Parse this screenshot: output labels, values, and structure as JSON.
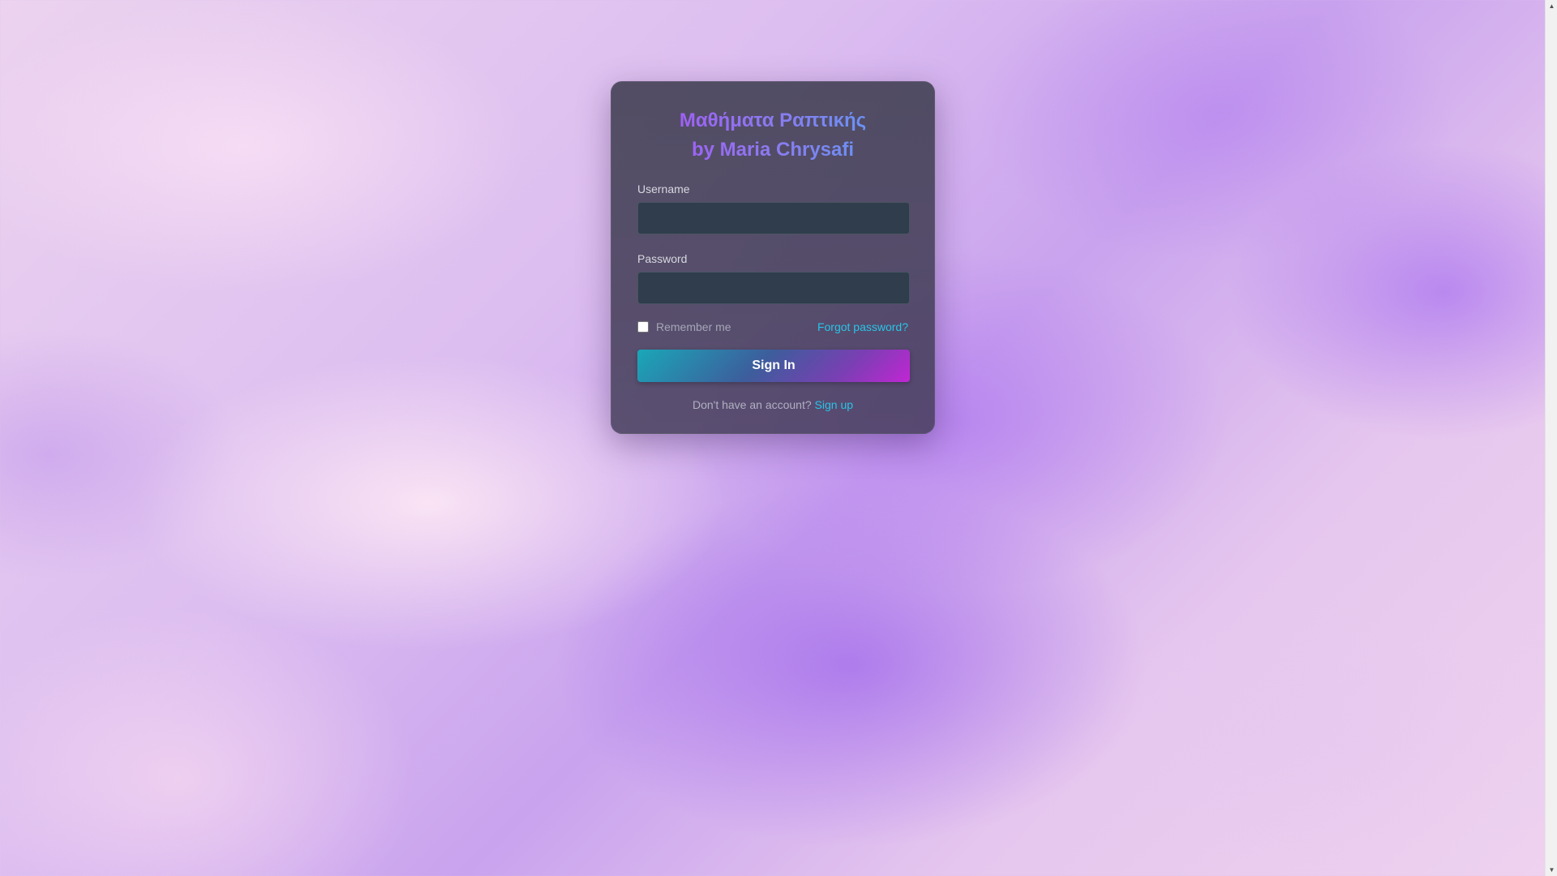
{
  "login": {
    "title_line1": "Μαθήματα Ραπτικής",
    "title_line2": "by Maria Chrysafi",
    "username_label": "Username",
    "username_value": "",
    "password_label": "Password",
    "password_value": "",
    "remember_label": "Remember me",
    "remember_checked": false,
    "forgot_link": "Forgot password?",
    "signin_label": "Sign In",
    "no_account_text": "Don't have an account?",
    "signup_link": "Sign up"
  },
  "colors": {
    "title_gradient_start": "#a855f7",
    "title_gradient_end": "#5b9cf6",
    "link": "#29c4e6",
    "input_background": "#2f3d4c",
    "button_gradient_start": "#1aa7b8",
    "button_gradient_end": "#c026d3"
  },
  "icons": {
    "scroll_up": "scroll-up-arrow-icon",
    "scroll_down": "scroll-down-arrow-icon"
  }
}
